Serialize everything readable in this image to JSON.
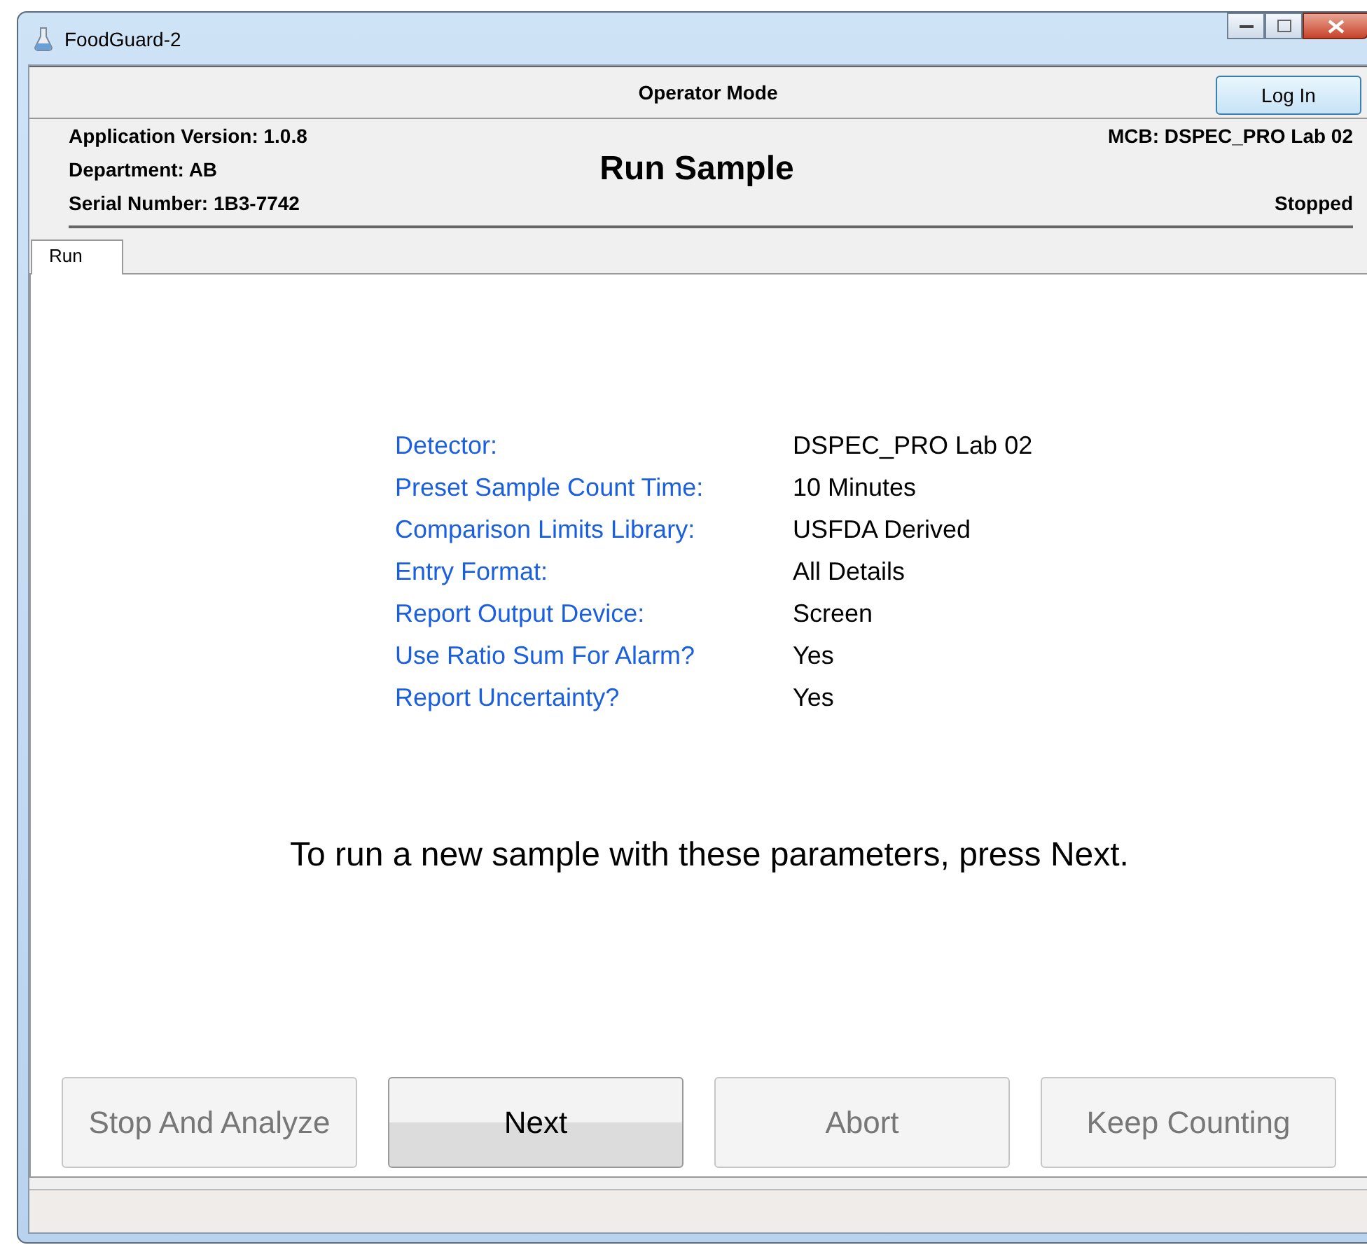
{
  "window": {
    "title": "FoodGuard-2"
  },
  "header": {
    "mode": "Operator Mode",
    "login_button": "Log In",
    "info_left": [
      "Application Version: 1.0.8",
      "Department: AB",
      "Serial Number: 1B3-7742"
    ],
    "title": "Run Sample",
    "mcb": "MCB: DSPEC_PRO Lab 02",
    "status": "Stopped"
  },
  "tabs": [
    {
      "label": "Run",
      "selected": true
    }
  ],
  "parameters": [
    {
      "label": "Detector:",
      "value": "DSPEC_PRO Lab 02"
    },
    {
      "label": "Preset Sample Count Time:",
      "value": "10 Minutes"
    },
    {
      "label": "Comparison Limits Library:",
      "value": "USFDA Derived"
    },
    {
      "label": "Entry Format:",
      "value": "All Details"
    },
    {
      "label": "Report Output Device:",
      "value": "Screen"
    },
    {
      "label": "Use Ratio Sum For Alarm?",
      "value": "Yes"
    },
    {
      "label": "Report Uncertainty?",
      "value": "Yes"
    }
  ],
  "instruction": "To run a new sample with these parameters, press Next.",
  "buttons": [
    {
      "label": "Stop And Analyze",
      "disabled": true
    },
    {
      "label": "Next",
      "disabled": false
    },
    {
      "label": "Abort",
      "disabled": true
    },
    {
      "label": "Keep Counting",
      "disabled": true
    }
  ]
}
